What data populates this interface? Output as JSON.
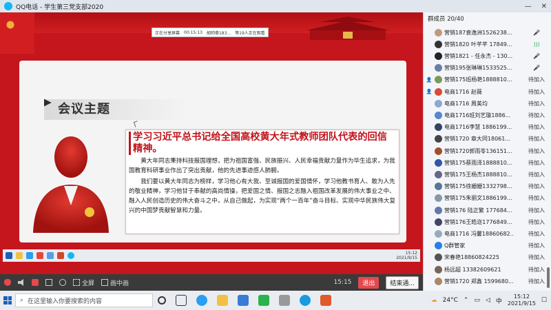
{
  "window": {
    "title": "QQ电话 - 学生第三党支部2020"
  },
  "share_banner": {
    "status": "正在分享屏幕",
    "time": "00:15:13",
    "sharer": "胡帅豪183...",
    "viewers": "等19人正在观看"
  },
  "slide": {
    "topic": "会议主题",
    "heading": "学习习近平总书记给全国高校黄大年式教师团队代表的回信精神。",
    "para1": "黄大年同志秉持科技报国理想，把为祖国富强、民族振兴、人民幸福贡献力量作为毕生追求，为我国教育科研事业作出了突出贡献，他的先进事迹感人肺腑。",
    "para2": "我们要以黄大年同志为榜样，学习他心有大我、至诚报国的爱国情怀，学习他教书育人、敢为人先的敬业精神，学习他甘于奉献的高尚情操，把爱国之情、报国之志融入祖国改革发展的伟大事业之中、融入人民创造历史的伟大奋斗之中，从自己做起，为实现“两个一百年”奋斗目标、实现中华民族伟大复兴的中国梦贡献智慧和力量。"
  },
  "inner_taskbar": {
    "time": "15:12",
    "date": "2021/9/15"
  },
  "controls": {
    "fullscreen": "全屏",
    "pip": "画中画",
    "timer": "15:15",
    "exit": "退出",
    "end": "结束通..."
  },
  "panel": {
    "header": "群成员 20/40",
    "members": [
      {
        "lead": "",
        "name": "营销187袁逸洲1526238...",
        "status": "mic-muted",
        "color": "#c29a7a"
      },
      {
        "lead": "",
        "name": "营销1820 叶芊芊 17849...",
        "status": "mic-on",
        "color": "#333333"
      },
      {
        "lead": "",
        "name": "营销1821 - 任永杰 - 130...",
        "status": "mic-muted",
        "color": "#222222"
      },
      {
        "lead": "",
        "name": "营销195张琳琳1533525...",
        "status": "mic-muted",
        "color": "#6a7fa6"
      },
      {
        "lead": "person",
        "name": "营销175班杨艳1888810...",
        "status": "待加入",
        "color": "#7a9a5a"
      },
      {
        "lead": "person",
        "name": "电商1716 赵薇",
        "status": "待加入",
        "color": "#d94a3a"
      },
      {
        "lead": "",
        "name": "电商1716 周美均",
        "status": "待加入",
        "color": "#88aacc"
      },
      {
        "lead": "",
        "name": "电商1716班刘艺璇1886...",
        "status": "待加入",
        "color": "#5588cc"
      },
      {
        "lead": "",
        "name": "电商1716李慧 1886199...",
        "status": "待加入",
        "color": "#334466"
      },
      {
        "lead": "",
        "name": "营销1720 章大同18061...",
        "status": "待加入",
        "color": "#444444"
      },
      {
        "lead": "",
        "name": "营销1720郭雨苓136151...",
        "status": "待加入",
        "color": "#a05030"
      },
      {
        "lead": "",
        "name": "营销175蔡雨泽1888810...",
        "status": "待加入",
        "color": "#3355aa"
      },
      {
        "lead": "",
        "name": "营销175王杨杰1888810...",
        "status": "待加入",
        "color": "#666688"
      },
      {
        "lead": "",
        "name": "营销175徐姗姗1332798...",
        "status": "待加入",
        "color": "#557799"
      },
      {
        "lead": "",
        "name": "营销175朱丽文1886199...",
        "status": "待加入",
        "color": "#8899aa"
      },
      {
        "lead": "",
        "name": "营销176 陆正繁 177684...",
        "status": "待加入",
        "color": "#6677aa"
      },
      {
        "lead": "",
        "name": "营销176王皓迩1776849...",
        "status": "待加入",
        "color": "#444466"
      },
      {
        "lead": "",
        "name": "电商1716 冯馨18860682...",
        "status": "待加入",
        "color": "#99aabb"
      },
      {
        "lead": "",
        "name": "Q群管家",
        "status": "待加入",
        "color": "#2b7de9"
      },
      {
        "lead": "",
        "name": "宋春艳18860824225",
        "status": "待加入",
        "color": "#555555"
      },
      {
        "lead": "",
        "name": "杨远超 13382609621",
        "status": "待加入",
        "color": "#776655"
      },
      {
        "lead": "",
        "name": "营销1720 郑鑫 1599680...",
        "status": "待加入",
        "color": "#aa8866"
      }
    ]
  },
  "taskbar": {
    "search_placeholder": "在这里输入你要搜索的内容",
    "temperature": "24°C",
    "time": "15:12",
    "date": "2021/9/15"
  }
}
